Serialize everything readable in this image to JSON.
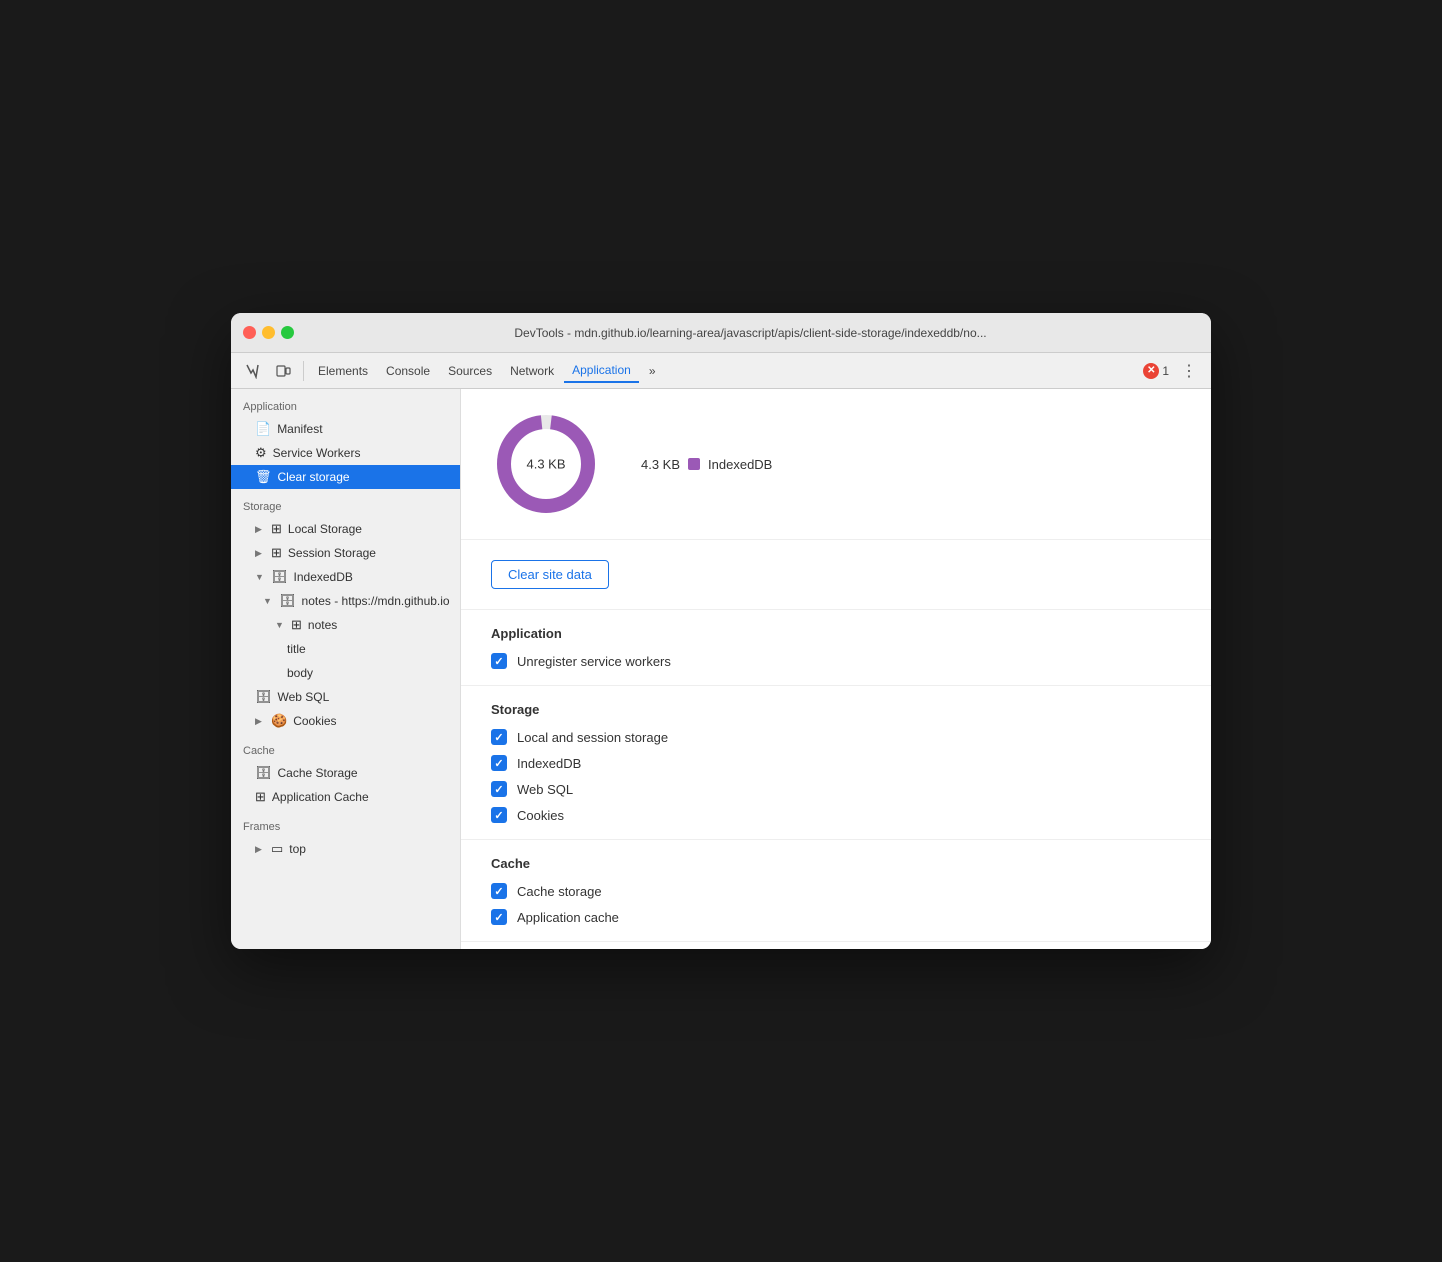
{
  "window": {
    "title": "DevTools - mdn.github.io/learning-area/javascript/apis/client-side-storage/indexeddb/no...",
    "traffic_lights": [
      "red",
      "yellow",
      "green"
    ]
  },
  "toolbar": {
    "inspect_icon": "⊡",
    "device_icon": "📱",
    "elements_label": "Elements",
    "console_label": "Console",
    "sources_label": "Sources",
    "network_label": "Network",
    "application_label": "Application",
    "more_label": "»",
    "error_count": "1",
    "more_options": "⋮"
  },
  "sidebar": {
    "application_label": "Application",
    "manifest_label": "Manifest",
    "service_workers_label": "Service Workers",
    "clear_storage_label": "Clear storage",
    "storage_label": "Storage",
    "local_storage_label": "Local Storage",
    "session_storage_label": "Session Storage",
    "indexeddb_label": "IndexedDB",
    "notes_db_label": "notes - https://mdn.github.io",
    "notes_store_label": "notes",
    "title_label": "title",
    "body_label": "body",
    "web_sql_label": "Web SQL",
    "cookies_label": "Cookies",
    "cache_label": "Cache",
    "cache_storage_label": "Cache Storage",
    "application_cache_label": "Application Cache",
    "frames_label": "Frames",
    "top_label": "top"
  },
  "chart": {
    "center_label": "4.3 KB",
    "legend": [
      {
        "size": "4.3 KB",
        "name": "IndexedDB",
        "color": "#9b59b6"
      }
    ]
  },
  "clear_section": {
    "button_label": "Clear site data"
  },
  "application_section": {
    "title": "Application",
    "items": [
      {
        "label": "Unregister service workers",
        "checked": true
      }
    ]
  },
  "storage_section": {
    "title": "Storage",
    "items": [
      {
        "label": "Local and session storage",
        "checked": true
      },
      {
        "label": "IndexedDB",
        "checked": true
      },
      {
        "label": "Web SQL",
        "checked": true
      },
      {
        "label": "Cookies",
        "checked": true
      }
    ]
  },
  "cache_section": {
    "title": "Cache",
    "items": [
      {
        "label": "Cache storage",
        "checked": true
      },
      {
        "label": "Application cache",
        "checked": true
      }
    ]
  }
}
